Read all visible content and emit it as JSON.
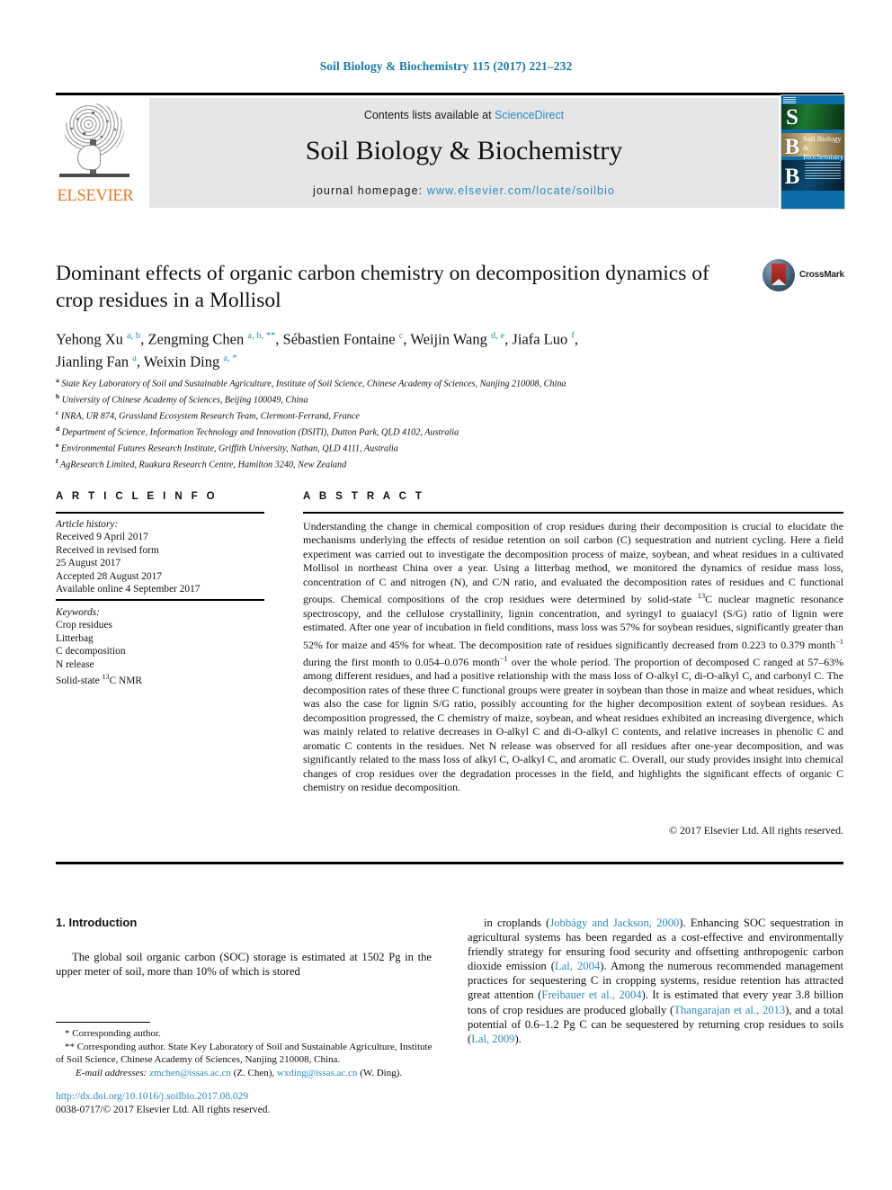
{
  "running_head": "Soil Biology & Biochemistry 115 (2017) 221–232",
  "masthead": {
    "contents_prefix": "Contents lists available at ",
    "sciencedirect": "ScienceDirect",
    "journal_title": "Soil Biology & Biochemistry",
    "homepage_prefix": "journal homepage: ",
    "homepage_url": "www.elsevier.com/locate/soilbio",
    "publisher": "ELSEVIER",
    "cover_letters": "S B B",
    "cover_name": "Soil Biology & Biochemistry",
    "accent_blue": "#2a8bbf",
    "elsevier_orange": "#e87722"
  },
  "article": {
    "title": "Dominant effects of organic carbon chemistry on decomposition dynamics of crop residues in a Mollisol",
    "crossmark_label": "CrossMark",
    "authors_line_1": "Yehong Xu <sup>a, b</sup>, Zengming Chen <sup>a, b, **</sup>, Sébastien Fontaine <sup>c</sup>, Weijin Wang <sup>d, e</sup>, Jiafa Luo <sup>f</sup>,",
    "authors_line_2": "Jianling Fan <sup>a</sup>, Weixin Ding <sup>a, *</sup>",
    "affiliations": [
      {
        "mark": "a",
        "text": "State Key Laboratory of Soil and Sustainable Agriculture, Institute of Soil Science, Chinese Academy of Sciences, Nanjing 210008, China"
      },
      {
        "mark": "b",
        "text": "University of Chinese Academy of Sciences, Beijing 100049, China"
      },
      {
        "mark": "c",
        "text": "INRA, UR 874, Grassland Ecosystem Research Team, Clermont-Ferrand, France"
      },
      {
        "mark": "d",
        "text": "Department of Science, Information Technology and Innovation (DSITI), Dutton Park, QLD 4102, Australia"
      },
      {
        "mark": "e",
        "text": "Environmental Futures Research Institute, Griffith University, Nathan, QLD 4111, Australia"
      },
      {
        "mark": "f",
        "text": "AgResearch Limited, Ruakura Research Centre, Hamilton 3240, New Zealand"
      }
    ]
  },
  "article_info": {
    "heading": "A R T I C L E  I N F O",
    "history_label": "Article history:",
    "history": [
      "Received 9 April 2017",
      "Received in revised form",
      "25 August 2017",
      "Accepted 28 August 2017",
      "Available online 4 September 2017"
    ],
    "keywords_label": "Keywords:",
    "keywords": [
      "Crop residues",
      "Litterbag",
      "C decomposition",
      "N release",
      "Solid-state <sup>13</sup>C NMR"
    ]
  },
  "abstract": {
    "heading": "A B S T R A C T",
    "body": "Understanding the change in chemical composition of crop residues during their decomposition is crucial to elucidate the mechanisms underlying the effects of residue retention on soil carbon (C) sequestration and nutrient cycling. Here a field experiment was carried out to investigate the decomposition process of maize, soybean, and wheat residues in a cultivated Mollisol in northeast China over a year. Using a litterbag method, we monitored the dynamics of residue mass loss, concentration of C and nitrogen (N), and C/N ratio, and evaluated the decomposition rates of residues and C functional groups. Chemical compositions of the crop residues were determined by solid-state <sup>13</sup>C nuclear magnetic resonance spectroscopy, and the cellulose crystallinity, lignin concentration, and syringyl to guaiacyl (S/G) ratio of lignin were estimated. After one year of incubation in field conditions, mass loss was 57% for soybean residues, significantly greater than 52% for maize and 45% for wheat. The decomposition rate of residues significantly decreased from 0.223 to 0.379 month<sup>−1</sup> during the first month to 0.054–0.076 month<sup>−1</sup> over the whole period. The proportion of decomposed C ranged at 57–63% among different residues, and had a positive relationship with the mass loss of O-alkyl C, di-O-alkyl C, and carbonyl C. The decomposition rates of these three C functional groups were greater in soybean than those in maize and wheat residues, which was also the case for lignin S/G ratio, possibly accounting for the higher decomposition extent of soybean residues. As decomposition progressed, the C chemistry of maize, soybean, and wheat residues exhibited an increasing divergence, which was mainly related to relative decreases in O-alkyl C and di-O-alkyl C contents, and relative increases in phenolic C and aromatic C contents in the residues. Net N release was observed for all residues after one-year decomposition, and was significantly related to the mass loss of alkyl C, O-alkyl C, and aromatic C. Overall, our study provides insight into chemical changes of crop residues over the degradation processes in the field, and highlights the significant effects of organic C chemistry on residue decomposition.",
    "copyright": "© 2017 Elsevier Ltd. All rights reserved."
  },
  "introduction": {
    "section_title": "1.  Introduction",
    "left_paragraph": "The global soil organic carbon (SOC) storage is estimated at 1502 Pg in the upper meter of soil, more than 10% of which is stored",
    "right_paragraph": "in croplands (<span class=\"cite\">Jobbágy and Jackson, 2000</span>). Enhancing SOC sequestration in agricultural systems has been regarded as a cost-effective and environmentally friendly strategy for ensuring food security and offsetting anthropogenic carbon dioxide emission (<span class=\"cite\">Lal, 2004</span>). Among the numerous recommended management practices for sequestering C in cropping systems, residue retention has attracted great attention (<span class=\"cite\">Freibauer et al., 2004</span>). It is estimated that every year 3.8 billion tons of crop residues are produced globally (<span class=\"cite\">Thangarajan et al., 2013</span>), and a total potential of 0.6–1.2 Pg C can be sequestered by returning crop residues to soils (<span class=\"cite\">Lal, 2009</span>)."
  },
  "footnotes": {
    "line1": "* Corresponding author.",
    "line2": "** Corresponding author. State Key Laboratory of Soil and Sustainable Agriculture, Institute of Soil Science, Chinese Academy of Sciences, Nanjing 210008, China.",
    "email_label": "E-mail addresses:",
    "email1": "zmchen@issas.ac.cn",
    "email1_owner": "(Z. Chen),",
    "email2": "wxding@issas.ac.cn",
    "email2_owner": "(W. Ding)."
  },
  "doi_block": {
    "doi": "http://dx.doi.org/10.1016/j.soilbio.2017.08.029",
    "issn": "0038-0717/© 2017 Elsevier Ltd. All rights reserved."
  }
}
